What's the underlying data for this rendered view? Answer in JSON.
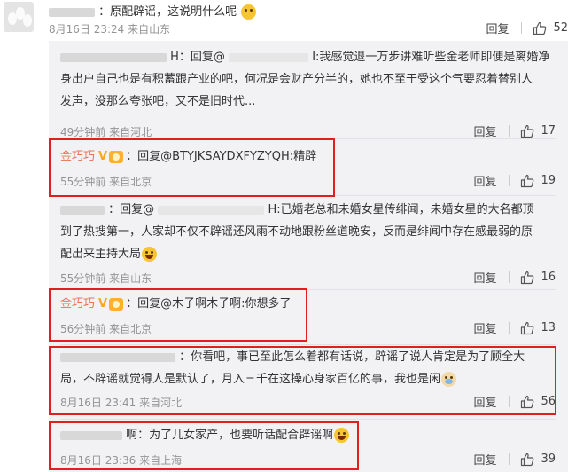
{
  "top_comment": {
    "text": "：原配辟谣，这说明什么呢",
    "time": "8月16日 23:24",
    "location": "来自山东",
    "reply_label": "回复",
    "likes": "52"
  },
  "replies": [
    {
      "lines": [
        "H：回复@",
        "I:我感觉退一万步讲难听些金老师即便是离婚净",
        "身出户自己也是有积蓄跟产业的吧，何况是会财产分半的，她也不至于受这个气要忍着替别人",
        "发声，没那么夸张吧，又不是旧时代..."
      ],
      "time": "49分钟前",
      "location": "来自河北",
      "reply_label": "回复",
      "likes": "17"
    },
    {
      "user": "金巧巧",
      "vip": "V",
      "text": "：回复@BTYJKSAYDXFYZYQH:精辟",
      "time": "55分钟前",
      "location": "来自北京",
      "reply_label": "回复",
      "likes": "19"
    },
    {
      "lines": [
        "：回复@",
        "H:已婚老总和未婚女星传绯闻，未婚女星的大名都顶",
        "到了热搜第一，人家却不仅不辟谣还风雨不动地跟粉丝道晚安，反而是绯闻中存在感最弱的原",
        "配出来主持大局"
      ],
      "time": "55分钟前",
      "location": "来自山东",
      "reply_label": "回复",
      "likes": "16"
    },
    {
      "user": "金巧巧",
      "vip": "V",
      "text": "：回复@木子啊木子啊:你想多了",
      "time": "56分钟前",
      "location": "来自北京",
      "reply_label": "回复",
      "likes": "13"
    },
    {
      "lines": [
        "：你看吧，事已至此怎么着都有话说，辟谣了说人肯定是为了顾全大",
        "局，不辟谣就觉得人是默认了，月入三千在这操心身家百亿的事，我也是闲"
      ],
      "time": "8月16日 23:41",
      "location": "来自河北",
      "reply_label": "回复",
      "likes": "56"
    },
    {
      "lines": [
        "啊：为了儿女家产，也要听话配合辟谣啊"
      ],
      "time": "8月16日 23:36",
      "location": "来自上海",
      "reply_label": "回复",
      "likes": "39"
    }
  ]
}
